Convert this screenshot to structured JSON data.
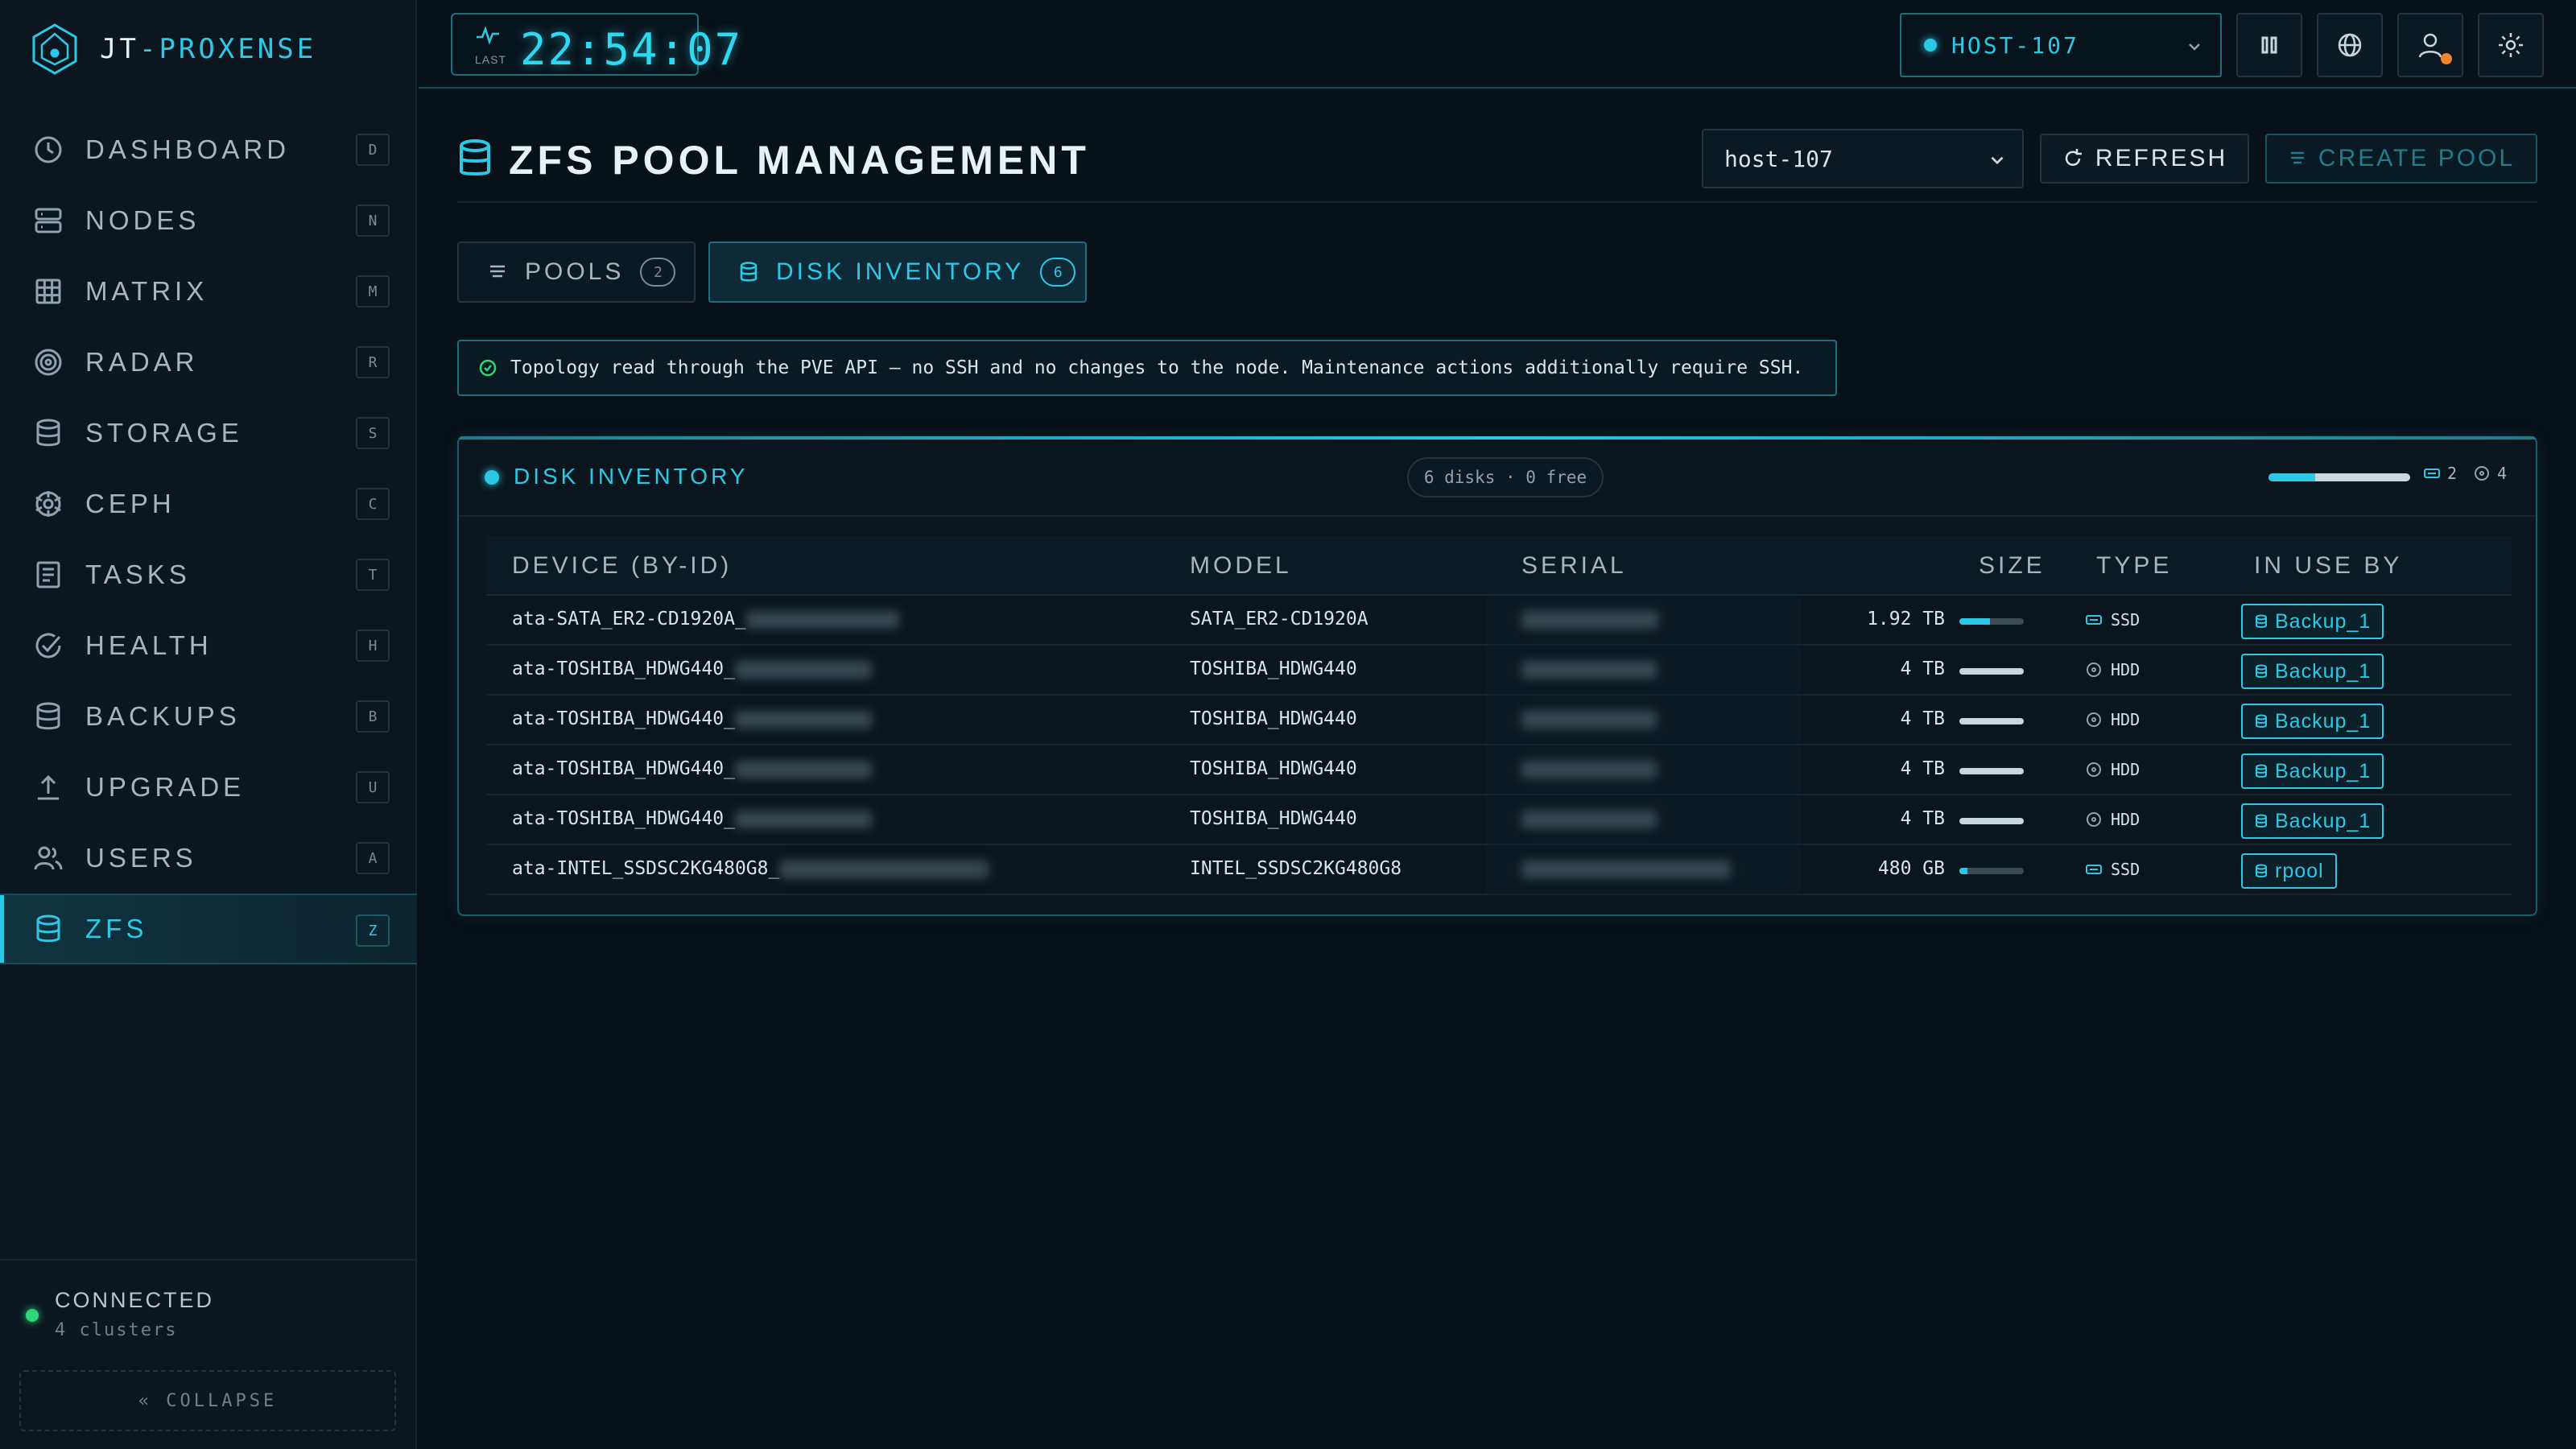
{
  "brand": {
    "prefix": "JT",
    "sep": "-",
    "name": "PROXENSE"
  },
  "sidebar": {
    "items": [
      {
        "label": "DASHBOARD",
        "key": "D",
        "icon": "clock-icon"
      },
      {
        "label": "NODES",
        "key": "N",
        "icon": "server-icon"
      },
      {
        "label": "MATRIX",
        "key": "M",
        "icon": "grid-icon"
      },
      {
        "label": "RADAR",
        "key": "R",
        "icon": "radar-icon"
      },
      {
        "label": "STORAGE",
        "key": "S",
        "icon": "database-icon"
      },
      {
        "label": "CEPH",
        "key": "C",
        "icon": "ceph-icon"
      },
      {
        "label": "TASKS",
        "key": "T",
        "icon": "tasks-icon"
      },
      {
        "label": "HEALTH",
        "key": "H",
        "icon": "check-circle-icon"
      },
      {
        "label": "BACKUPS",
        "key": "B",
        "icon": "database-icon"
      },
      {
        "label": "UPGRADE",
        "key": "U",
        "icon": "upload-icon"
      },
      {
        "label": "USERS",
        "key": "A",
        "icon": "users-icon"
      },
      {
        "label": "ZFS",
        "key": "Z",
        "icon": "database-icon",
        "active": true
      }
    ],
    "status": {
      "title": "CONNECTED",
      "sub": "4 clusters"
    },
    "collapse_label": "« COLLAPSE"
  },
  "topbar": {
    "clock": {
      "caption": "LAST",
      "time": "22:54:07"
    },
    "host": "HOST-107"
  },
  "page": {
    "title": "ZFS POOL MANAGEMENT",
    "node_select": "host-107",
    "refresh_label": "REFRESH",
    "create_label": "CREATE POOL"
  },
  "tabs": [
    {
      "label": "POOLS",
      "count": "2"
    },
    {
      "label": "DISK INVENTORY",
      "count": "6"
    }
  ],
  "banner": "Topology read through the PVE API — no SSH and no changes to the node. Maintenance actions additionally require SSH.",
  "panel": {
    "title": "DISK INVENTORY",
    "pill": "6 disks · 0 free",
    "ssd_count": "2",
    "hdd_count": "4",
    "ssd_fraction": 0.33,
    "columns": [
      "DEVICE (BY-ID)",
      "MODEL",
      "SERIAL",
      "SIZE",
      "TYPE",
      "IN USE BY"
    ],
    "rows": [
      {
        "device": "ata-SATA_ER2-CD1920A_",
        "model": "SATA_ER2-CD1920A",
        "size": "1.92 TB",
        "type": "SSD",
        "used_by": "Backup_1",
        "size_fraction": 0.48
      },
      {
        "device": "ata-TOSHIBA_HDWG440_",
        "model": "TOSHIBA_HDWG440",
        "size": "4 TB",
        "type": "HDD",
        "used_by": "Backup_1",
        "size_fraction": 1.0
      },
      {
        "device": "ata-TOSHIBA_HDWG440_",
        "model": "TOSHIBA_HDWG440",
        "size": "4 TB",
        "type": "HDD",
        "used_by": "Backup_1",
        "size_fraction": 1.0
      },
      {
        "device": "ata-TOSHIBA_HDWG440_",
        "model": "TOSHIBA_HDWG440",
        "size": "4 TB",
        "type": "HDD",
        "used_by": "Backup_1",
        "size_fraction": 1.0
      },
      {
        "device": "ata-TOSHIBA_HDWG440_",
        "model": "TOSHIBA_HDWG440",
        "size": "4 TB",
        "type": "HDD",
        "used_by": "Backup_1",
        "size_fraction": 1.0
      },
      {
        "device": "ata-INTEL_SSDSC2KG480G8_",
        "model": "INTEL_SSDSC2KG480G8",
        "size": "480 GB",
        "type": "SSD",
        "used_by": "rpool",
        "size_fraction": 0.12
      }
    ]
  },
  "colors": {
    "accent": "#2cc9e6",
    "ok": "#2fd67a",
    "warn": "#f2862b",
    "background": "#081018"
  }
}
